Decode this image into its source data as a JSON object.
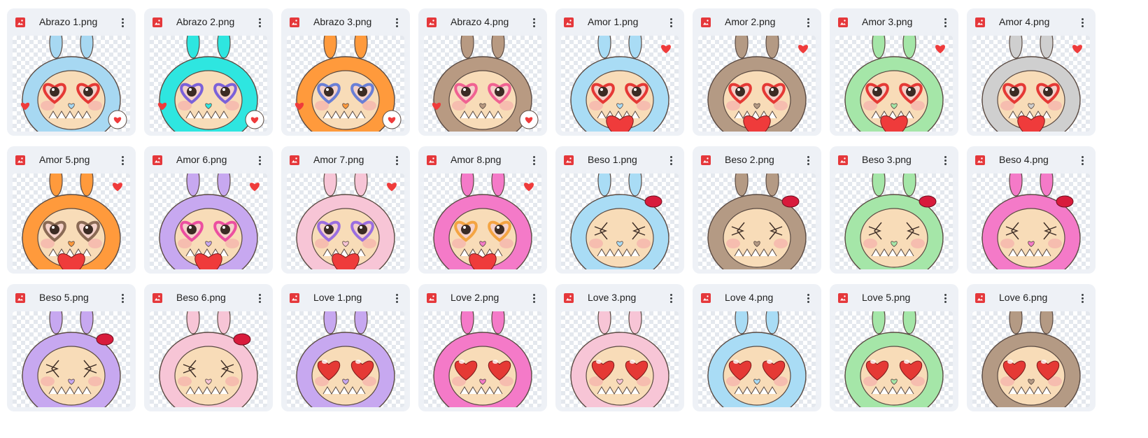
{
  "files": [
    {
      "name": "Abrazo 1.png",
      "fur": "#a7d8f2",
      "accent": "#e53935",
      "icon": "image-file-icon"
    },
    {
      "name": "Abrazo 2.png",
      "fur": "#2ee6e0",
      "accent": "#7b61d9",
      "icon": "image-file-icon"
    },
    {
      "name": "Abrazo 3.png",
      "fur": "#ff9a3c",
      "accent": "#6a7fd6",
      "icon": "image-file-icon"
    },
    {
      "name": "Abrazo 4.png",
      "fur": "#b89a82",
      "accent": "#f06292",
      "icon": "image-file-icon"
    },
    {
      "name": "Amor 1.png",
      "fur": "#a9dcf5",
      "accent": "#e53935",
      "icon": "image-file-icon"
    },
    {
      "name": "Amor 2.png",
      "fur": "#b49a84",
      "accent": "#e53935",
      "icon": "image-file-icon"
    },
    {
      "name": "Amor 3.png",
      "fur": "#a5e6a8",
      "accent": "#e53935",
      "icon": "image-file-icon"
    },
    {
      "name": "Amor 4.png",
      "fur": "#cfcfcf",
      "accent": "#e53935",
      "icon": "image-file-icon"
    },
    {
      "name": "Amor 5.png",
      "fur": "#ff9a3c",
      "accent": "#8a6a55",
      "icon": "image-file-icon"
    },
    {
      "name": "Amor 6.png",
      "fur": "#c7a8f0",
      "accent": "#ec4fa0",
      "icon": "image-file-icon"
    },
    {
      "name": "Amor 7.png",
      "fur": "#f7c5d6",
      "accent": "#9b6ee0",
      "icon": "image-file-icon"
    },
    {
      "name": "Amor 8.png",
      "fur": "#f47ac8",
      "accent": "#f4a442",
      "icon": "image-file-icon"
    },
    {
      "name": "Beso 1.png",
      "fur": "#a9dcf5",
      "accent": "#d81b3c",
      "icon": "image-file-icon"
    },
    {
      "name": "Beso 2.png",
      "fur": "#b49a84",
      "accent": "#d81b3c",
      "icon": "image-file-icon"
    },
    {
      "name": "Beso 3.png",
      "fur": "#a5e6a8",
      "accent": "#d81b3c",
      "icon": "image-file-icon"
    },
    {
      "name": "Beso 4.png",
      "fur": "#f47ac8",
      "accent": "#d81b3c",
      "icon": "image-file-icon"
    },
    {
      "name": "Beso 5.png",
      "fur": "#c7a8f0",
      "accent": "#d81b3c",
      "icon": "image-file-icon"
    },
    {
      "name": "Beso 6.png",
      "fur": "#f7c5d6",
      "accent": "#d81b3c",
      "icon": "image-file-icon"
    },
    {
      "name": "Love 1.png",
      "fur": "#c7a8f0",
      "accent": "#e53935",
      "icon": "image-file-icon"
    },
    {
      "name": "Love 2.png",
      "fur": "#f47ac8",
      "accent": "#e53935",
      "icon": "image-file-icon"
    },
    {
      "name": "Love 3.png",
      "fur": "#f7c5d6",
      "accent": "#e53935",
      "icon": "image-file-icon"
    },
    {
      "name": "Love 4.png",
      "fur": "#a9dcf5",
      "accent": "#e53935",
      "icon": "image-file-icon"
    },
    {
      "name": "Love 5.png",
      "fur": "#a5e6a8",
      "accent": "#e53935",
      "icon": "image-file-icon"
    },
    {
      "name": "Love 6.png",
      "fur": "#b49a84",
      "accent": "#e53935",
      "icon": "image-file-icon"
    }
  ]
}
